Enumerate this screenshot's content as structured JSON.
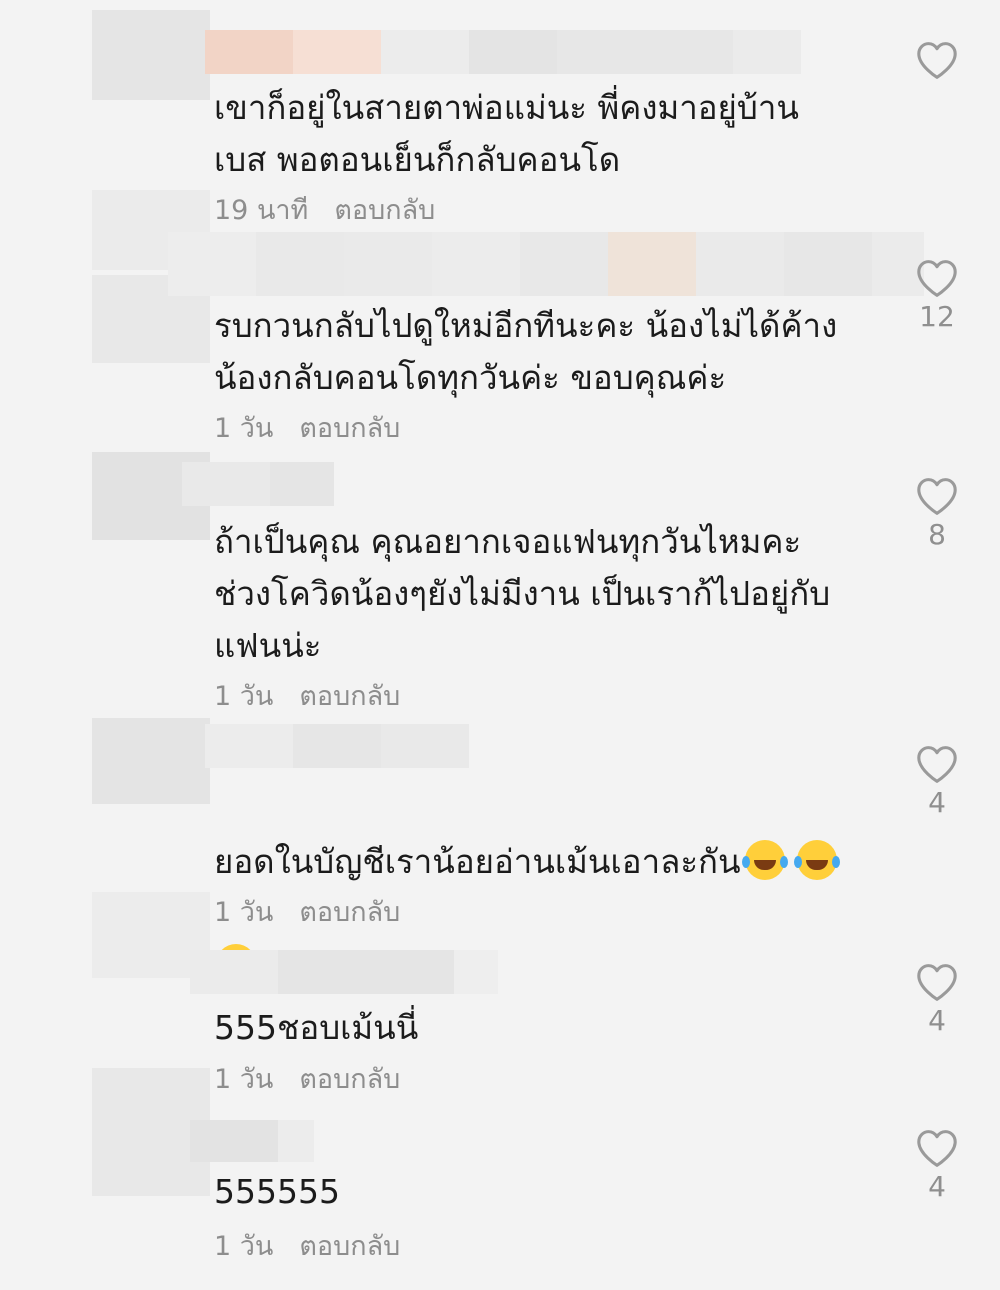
{
  "comments": [
    {
      "text": "เขาก็อยู่ในสายตาพ่อแม่นะ พี่คงมาอยู่บ้าน\nเบส พอตอนเย็นก็กลับคอนโด",
      "time": "19 นาที",
      "reply": "ตอบกลับ",
      "likes": ""
    },
    {
      "text": "รบกวนกลับไปดูใหม่อีกทีนะคะ น้องไม่ได้ค้าง\nน้องกลับคอนโดทุกวันค่ะ ขอบคุณค่ะ",
      "time": "1 วัน",
      "reply": "ตอบกลับ",
      "likes": "12"
    },
    {
      "text": "ถ้าเป็นคุณ คุณอยากเจอแฟนทุกวันไหมคะ\nช่วงโควิดน้องๆยังไม่มีงาน เป็นเราก้ไปอยู่กับ\nแฟนน่ะ",
      "time": "1 วัน",
      "reply": "ตอบกลับ",
      "likes": "8"
    },
    {
      "text_line1": "ยอดในบัญชีเราน้อยอ่านเม้นเอาละกัน",
      "time": "1 วัน",
      "reply": "ตอบกลับ",
      "likes": "4",
      "emojis": [
        "face-with-tears-of-joy",
        "face-with-tears-of-joy",
        "face-with-tears-of-joy"
      ]
    },
    {
      "text": "555ชอบเม้นนี่",
      "time": "1 วัน",
      "reply": "ตอบกลับ",
      "likes": "4"
    },
    {
      "text": "555555",
      "time": "1 วัน",
      "reply": "ตอบกลับ",
      "likes": "4"
    }
  ],
  "colors": {
    "background": "#f3f3f3",
    "text": "#1b1b1b",
    "meta": "#8d8d8d",
    "heart_outline": "#9a9a9a"
  }
}
